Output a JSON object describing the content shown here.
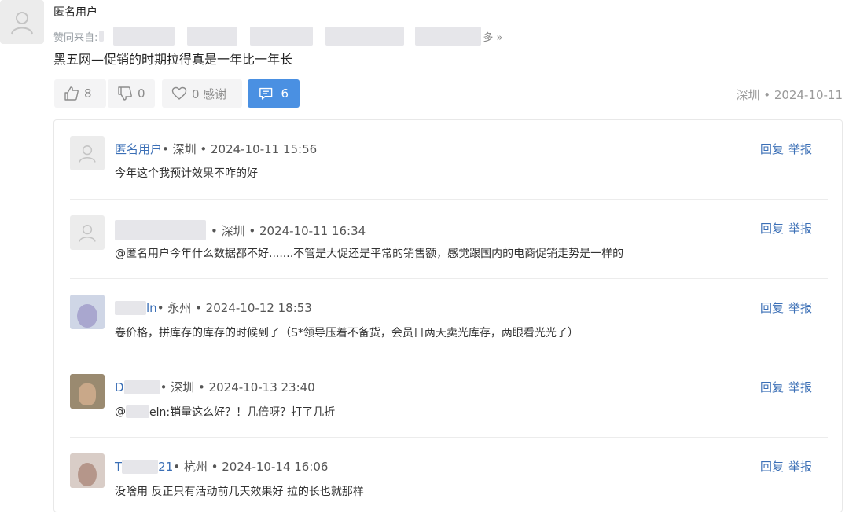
{
  "post": {
    "author": "匿名用户",
    "endorse_prefix": "赞同来自:",
    "endorse_suffix": "多 »",
    "body": "黑五网—促销的时期拉得真是一年比一年长",
    "upvote_count": "8",
    "downvote_count": "0",
    "thanks_label": "0 感谢",
    "reply_count": "6",
    "meta": "深圳 • 2024-10-11"
  },
  "comments": [
    {
      "name": "匿名用户",
      "meta": " • 深圳 • 2024-10-11 15:56",
      "text": "今年这个我预计效果不咋的好",
      "reply": "回复",
      "report": "举报"
    },
    {
      "name": "",
      "meta": "• 深圳 • 2024-10-11 16:34",
      "text": "@匿名用户今年什么数据都不好.......不管是大促还是平常的销售额，感觉跟国内的电商促销走势是一样的",
      "reply": "回复",
      "report": "举报"
    },
    {
      "name": "ln",
      "meta": " • 永州 • 2024-10-12 18:53",
      "text": "卷价格，拼库存的库存的时候到了（S*领导压着不备货，会员日两天卖光库存，两眼看光光了）",
      "reply": "回复",
      "report": "举报"
    },
    {
      "name": "D",
      "meta": " • 深圳 • 2024-10-13 23:40",
      "text_prefix": "@",
      "text": "eln:销量这么好？！几倍呀？打了几折",
      "reply": "回复",
      "report": "举报"
    },
    {
      "name": "T",
      "name_tail": "21",
      "meta": " • 杭州 • 2024-10-14 16:06",
      "text": "没啥用 反正只有活动前几天效果好 拉的长也就那样",
      "reply": "回复",
      "report": "举报"
    }
  ],
  "colors": {
    "accent": "#4a90e2",
    "link": "#3b6fb6"
  }
}
